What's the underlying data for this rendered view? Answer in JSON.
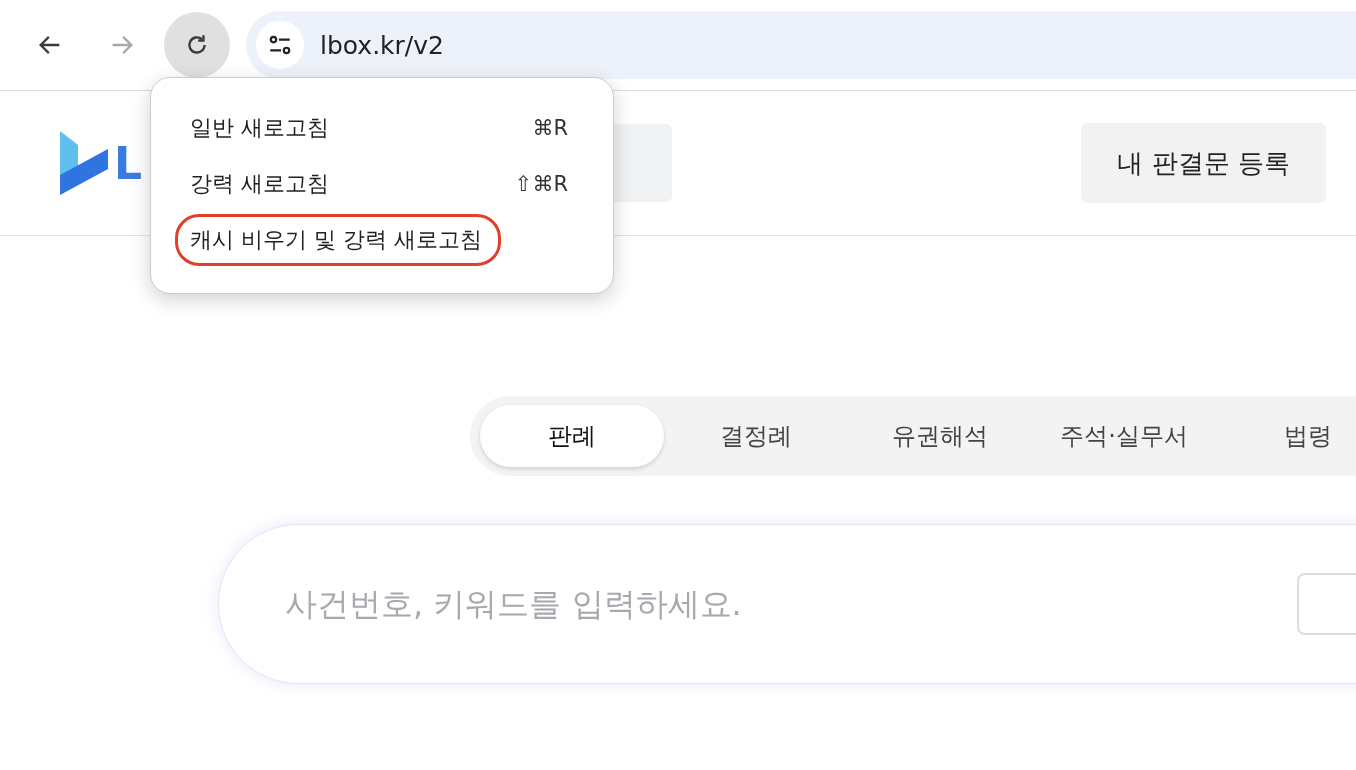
{
  "browser": {
    "url": "lbox.kr/v2",
    "back_disabled": false,
    "forward_disabled": true,
    "reload_pressed": true
  },
  "reload_menu": {
    "items": [
      {
        "label": "일반 새로고침",
        "shortcut": "⌘R",
        "highlighted": false
      },
      {
        "label": "강력 새로고침",
        "shortcut": "⇧⌘R",
        "highlighted": false
      },
      {
        "label": "캐시 비우기 및 강력 새로고침",
        "highlighted": true
      }
    ]
  },
  "header": {
    "logo_text": "L",
    "register_button": "내 판결문 등록"
  },
  "tabs": [
    {
      "label": "판례",
      "selected": true
    },
    {
      "label": "결정례",
      "selected": false
    },
    {
      "label": "유권해석",
      "selected": false
    },
    {
      "label": "주석·실무서",
      "selected": false
    },
    {
      "label": "법령",
      "selected": false
    }
  ],
  "search": {
    "placeholder": "사건번호, 키워드를 입력하세요."
  }
}
